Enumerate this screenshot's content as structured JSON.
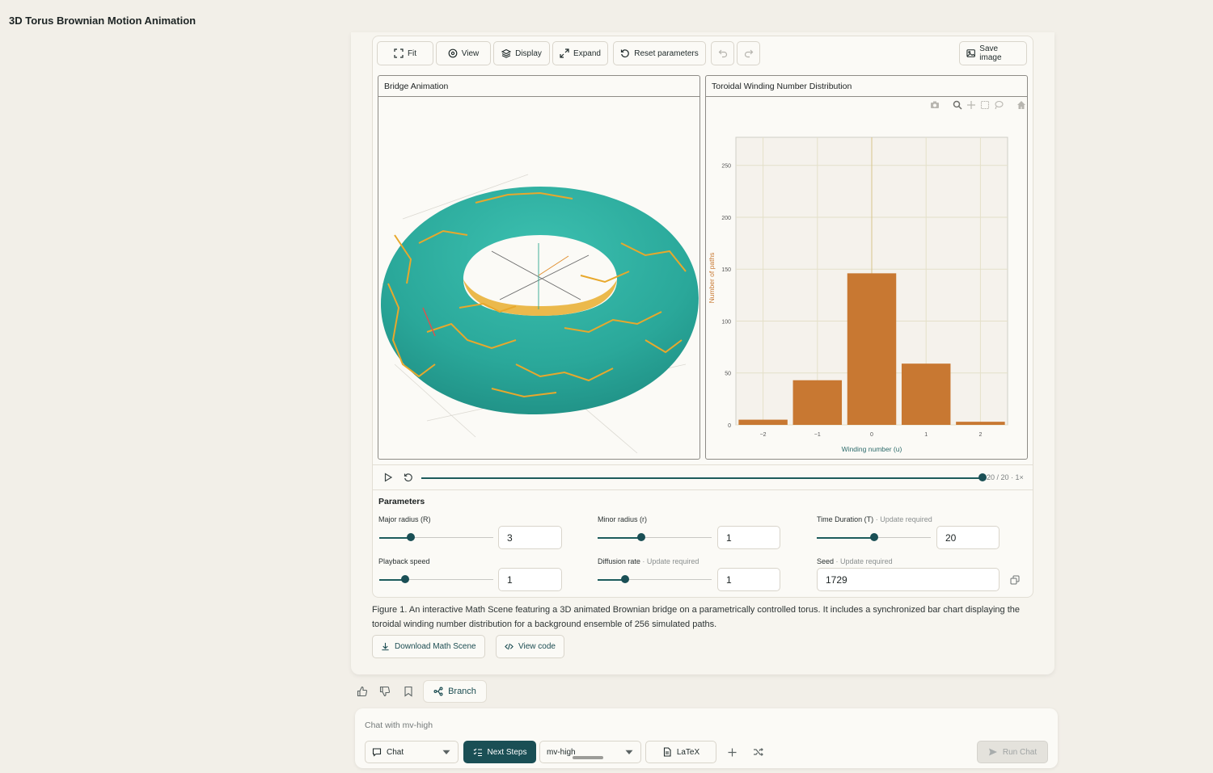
{
  "app": {
    "title": "3D Torus Brownian Motion Animation"
  },
  "toolbar": {
    "fit": "Fit",
    "view": "View",
    "display": "Display",
    "expand": "Expand",
    "reset": "Reset parameters",
    "save": "Save image"
  },
  "panels": {
    "left_title": "Bridge Animation",
    "right_title": "Toroidal Winding Number Distribution"
  },
  "colors": {
    "accent": "#1a4f55",
    "torus": "#2aa89a",
    "paths": "#e8a82c",
    "bars": "#c87832"
  },
  "playback": {
    "label": "20 / 20 · 1×",
    "progress": 1.0
  },
  "params": {
    "title": "Parameters",
    "update_note": "· Update required",
    "major_radius": {
      "label": "Major radius (R)",
      "value": "3",
      "level": 0.28
    },
    "minor_radius": {
      "label": "Minor radius (r)",
      "value": "1",
      "level": 0.38
    },
    "time_duration": {
      "label": "Time Duration (T)",
      "value": "20",
      "level": 0.5
    },
    "playback_speed": {
      "label": "Playback speed",
      "value": "1",
      "level": 0.23
    },
    "diffusion_rate": {
      "label": "Diffusion rate",
      "value": "1",
      "level": 0.24
    },
    "seed": {
      "label": "Seed",
      "value": "1729"
    }
  },
  "caption": "Figure 1. An interactive Math Scene featuring a 3D animated Brownian bridge on a parametrically controlled torus. It includes a synchronized bar chart displaying the toroidal winding number distribution for a background ensemble of 256 simulated paths.",
  "actions": {
    "download": "Download Math Scene",
    "view_code": "View code",
    "branch": "Branch"
  },
  "chat": {
    "placeholder": "Chat with mv-high",
    "mode": "Chat",
    "next_steps": "Next Steps",
    "model": "mv-high",
    "latex": "LaTeX",
    "run": "Run Chat"
  },
  "chart_data": {
    "type": "bar",
    "title": "",
    "xlabel": "Winding number (u)",
    "ylabel": "Number of paths",
    "categories": [
      "−2",
      "−1",
      "0",
      "1",
      "2"
    ],
    "x": [
      -2,
      -1,
      0,
      1,
      2
    ],
    "values": [
      5,
      43,
      146,
      59,
      3
    ],
    "ylim": [
      0,
      277
    ],
    "yticks": [
      0,
      50,
      100,
      150,
      200,
      250
    ],
    "grid": true
  }
}
